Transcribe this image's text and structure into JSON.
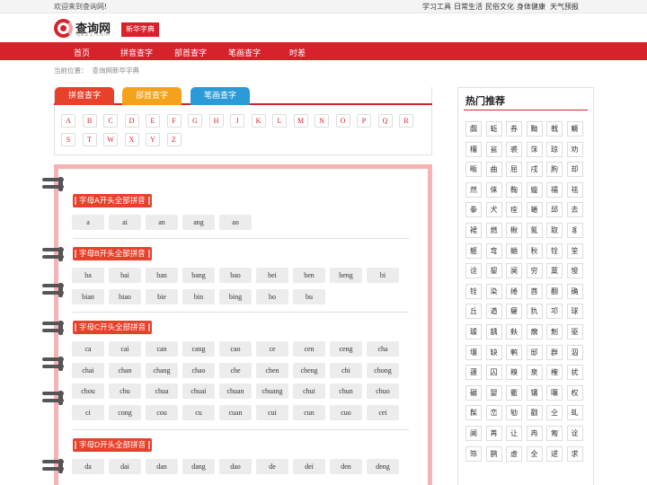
{
  "topbar": {
    "welcome": "欢迎来到查询网!",
    "links": [
      "学习工具",
      "日常生活",
      "民俗文化",
      "身体健康",
      "天气预报"
    ]
  },
  "header": {
    "logo_name": "查询网",
    "logo_domain": "q821.com",
    "dict_badge": "新华字典"
  },
  "nav": [
    "首页",
    "拼音查字",
    "部首查字",
    "笔画查字",
    "时差"
  ],
  "breadcrumb": [
    "当前位置：",
    "查询网新华字典"
  ],
  "tabs": [
    "拼音查字",
    "部首查字",
    "笔画查字"
  ],
  "letters": [
    "A",
    "B",
    "C",
    "D",
    "E",
    "F",
    "G",
    "H",
    "J",
    "K",
    "L",
    "M",
    "N",
    "O",
    "P",
    "Q",
    "R",
    "S",
    "T",
    "W",
    "X",
    "Y",
    "Z"
  ],
  "sections": [
    {
      "title": "字母A开头全部拼音",
      "items": [
        "a",
        "ai",
        "an",
        "ang",
        "ao"
      ]
    },
    {
      "title": "字母B开头全部拼音",
      "items": [
        "ba",
        "bai",
        "ban",
        "bang",
        "bao",
        "bei",
        "ben",
        "beng",
        "bi",
        "bian",
        "biao",
        "bie",
        "bin",
        "bing",
        "bo",
        "bu"
      ]
    },
    {
      "title": "字母C开头全部拼音",
      "items": [
        "ca",
        "cai",
        "can",
        "cang",
        "cao",
        "ce",
        "cen",
        "ceng",
        "cha",
        "chai",
        "chan",
        "chang",
        "chao",
        "che",
        "chen",
        "cheng",
        "chi",
        "chong",
        "chou",
        "chu",
        "chua",
        "chuai",
        "chuan",
        "chuang",
        "chui",
        "chun",
        "chuo",
        "ci",
        "cong",
        "cou",
        "cu",
        "cuan",
        "cui",
        "cun",
        "cuo",
        "cei"
      ]
    },
    {
      "title": "字母D开头全部拼音",
      "items": [
        "da",
        "dai",
        "dan",
        "dang",
        "dao",
        "de",
        "dei",
        "den",
        "deng"
      ]
    }
  ],
  "sidebar": {
    "title": "热门推荐",
    "chars": [
      "觑",
      "蚯",
      "券",
      "黝",
      "戟",
      "鳜",
      "穰",
      "瓮",
      "裘",
      "莯",
      "琼",
      "劝",
      "畈",
      "曲",
      "屈",
      "戌",
      "朐",
      "却",
      "然",
      "俫",
      "鞠",
      "嫙",
      "襦",
      "祛",
      "拳",
      "犬",
      "痊",
      "蜷",
      "邱",
      "去",
      "裙",
      "燃",
      "楸",
      "氰",
      "取",
      "豸",
      "躯",
      "弯",
      "蛐",
      "秋",
      "铨",
      "筌",
      "诠",
      "鋆",
      "阒",
      "穷",
      "藁",
      "悛",
      "铨",
      "染",
      "绻",
      "酋",
      "翻",
      "确",
      "丘",
      "遒",
      "癯",
      "犰",
      "邛",
      "球",
      "璩",
      "龋",
      "麸",
      "瘸",
      "魝",
      "驱",
      "壤",
      "缺",
      "鹌",
      "邸",
      "群",
      "泅",
      "蘧",
      "囚",
      "糗",
      "泉",
      "榷",
      "扰",
      "碾",
      "婴",
      "衢",
      "镶",
      "嚷",
      "权",
      "髹",
      "峦",
      "劬",
      "戳",
      "仝",
      "虬",
      "阒",
      "苒",
      "让",
      "冉",
      "匍",
      "诠",
      "筇",
      "鹊",
      "虚",
      "全",
      "逑",
      "求"
    ]
  }
}
